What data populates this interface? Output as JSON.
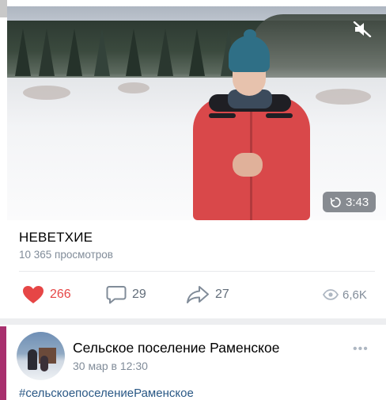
{
  "video": {
    "duration": "3:43",
    "title": "НЕВЕТХИЕ",
    "views_text": "10 365 просмотров"
  },
  "actions": {
    "likes": "266",
    "comments": "29",
    "shares": "27",
    "views": "6,6K"
  },
  "post": {
    "author": "Сельское поселение Раменское",
    "date": "30 мар в 12:30",
    "hashtag": "#сельскоепоселениеРаменское",
    "more": "•••"
  },
  "colors": {
    "like": "#e64646",
    "link": "#2a5885",
    "secondary": "#818c99"
  }
}
